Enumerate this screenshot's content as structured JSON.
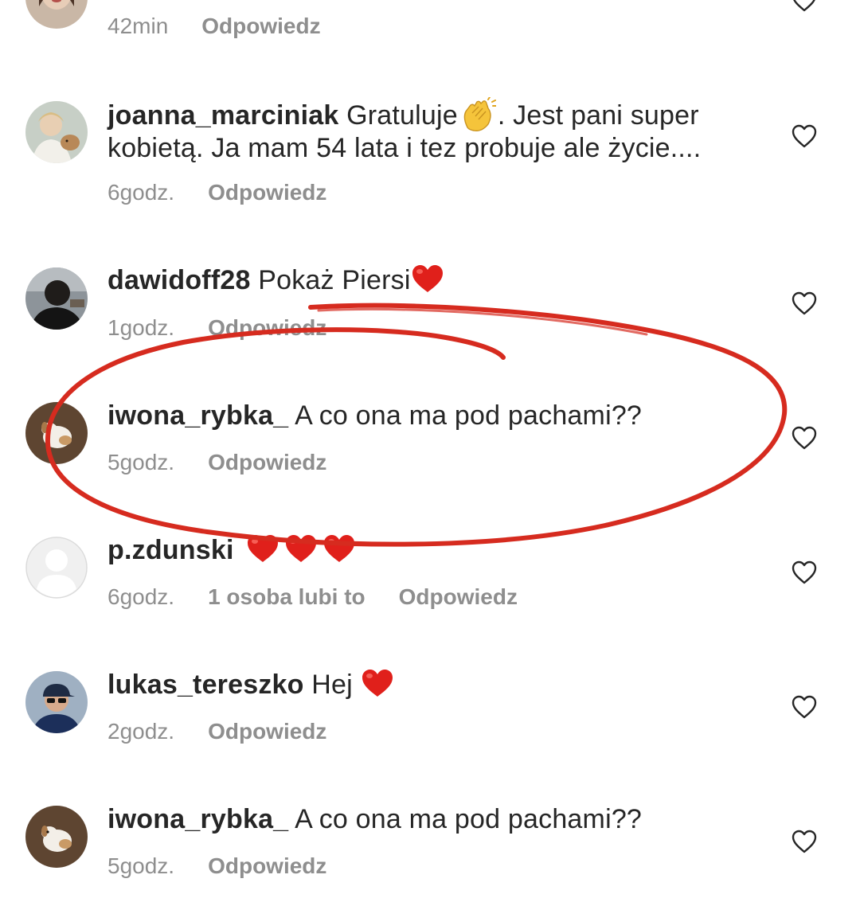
{
  "comments": [
    {
      "username": "",
      "text": "",
      "time": "42min",
      "likes": "",
      "reply_label": "Odpowiedz",
      "avatar": "woman-portrait"
    },
    {
      "username": "joanna_marciniak",
      "text_before": "Gratuluje",
      "emoji": "clapping-hands",
      "text_after": ". Jest pani super",
      "text_line2": "kobietą. Ja mam 54 lata i tez probuje ale życie....",
      "time": "6godz.",
      "reply_label": "Odpowiedz",
      "avatar": "woman-with-dog"
    },
    {
      "username": "dawidoff28",
      "text": "Pokaż Piersi",
      "emoji": "red-heart",
      "time": "1godz.",
      "reply_label": "Odpowiedz",
      "avatar": "man-silhouette"
    },
    {
      "username": "iwona_rybka_",
      "text": "A co ona ma pod pachami??",
      "time": "5godz.",
      "reply_label": "Odpowiedz",
      "avatar": "dog-photo"
    },
    {
      "username": "p.zdunski",
      "text": "",
      "emoji": "three-red-hearts",
      "time": "6godz.",
      "likes": "1 osoba lubi to",
      "reply_label": "Odpowiedz",
      "avatar": "default-avatar"
    },
    {
      "username": "lukas_tereszko",
      "text": "Hej",
      "emoji": "red-heart",
      "time": "2godz.",
      "reply_label": "Odpowiedz",
      "avatar": "man-cap-sunglasses"
    },
    {
      "username": "iwona_rybka_",
      "text": "A co ona ma pod pachami??",
      "time": "5godz.",
      "reply_label": "Odpowiedz",
      "avatar": "dog-photo"
    }
  ],
  "icons": {
    "like": "heart-outline-icon"
  },
  "colors": {
    "annotation": "#d62b1f",
    "meta_text": "#8e8e8e",
    "primary_text": "#262626",
    "emoji_heart": "#e0201b"
  }
}
